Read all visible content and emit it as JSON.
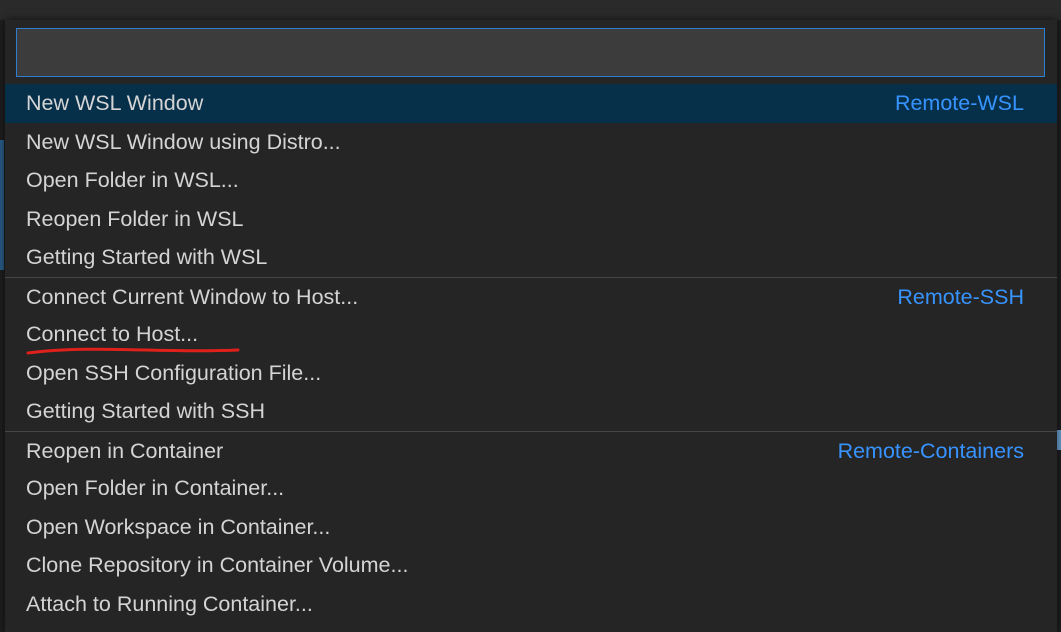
{
  "quick_pick": {
    "input_value": "",
    "items": [
      {
        "label": "New WSL Window",
        "group": "Remote-WSL",
        "selected": true
      },
      {
        "label": "New WSL Window using Distro...",
        "group": ""
      },
      {
        "label": "Open Folder in WSL...",
        "group": ""
      },
      {
        "label": "Reopen Folder in WSL",
        "group": ""
      },
      {
        "label": "Getting Started with WSL",
        "group": ""
      },
      {
        "label": "Connect Current Window to Host...",
        "group": "Remote-SSH"
      },
      {
        "label": "Connect to Host...",
        "group": "",
        "annotated_underline": true
      },
      {
        "label": "Open SSH Configuration File...",
        "group": ""
      },
      {
        "label": "Getting Started with SSH",
        "group": ""
      },
      {
        "label": "Reopen in Container",
        "group": "Remote-Containers"
      },
      {
        "label": "Open Folder in Container...",
        "group": ""
      },
      {
        "label": "Open Workspace in Container...",
        "group": ""
      },
      {
        "label": "Clone Repository in Container Volume...",
        "group": ""
      },
      {
        "label": "Attach to Running Container...",
        "group": ""
      }
    ]
  },
  "colors": {
    "accent": "#3794ff",
    "selection": "#062f4a",
    "annotation": "#e0201a"
  }
}
